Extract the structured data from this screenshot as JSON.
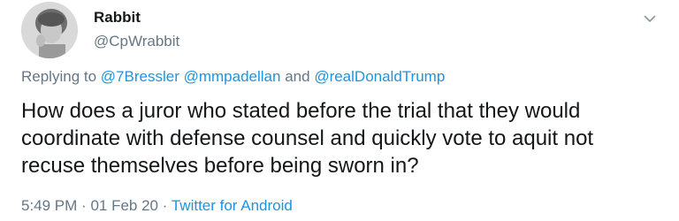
{
  "tweet": {
    "display_name": "Rabbit",
    "handle": "@CpWrabbit",
    "reply": {
      "prefix": "Replying to",
      "mentions": [
        "@7Bressler",
        "@mmpadellan",
        "@realDonaldTrump"
      ],
      "conjunction": "and"
    },
    "text": "How does a juror who stated before the trial that they would coordinate with defense counsel and quickly vote to aquit not recuse themselves before being sworn in?",
    "time": "5:49 PM",
    "separator": "·",
    "date": "01 Feb 20",
    "source": "Twitter for Android"
  },
  "icons": {
    "avatar": "profile-photo",
    "menu": "chevron-down-icon"
  },
  "colors": {
    "text": "#14171a",
    "secondary": "#657786",
    "link": "#1b95e0"
  }
}
